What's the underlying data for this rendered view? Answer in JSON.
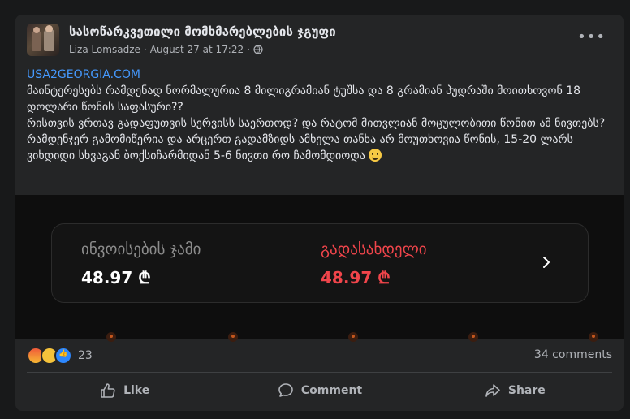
{
  "header": {
    "group_name": "სასოწარკვეთილი მომხმარებლების ჯგუფი",
    "author": "Liza Lomsadze",
    "separator": "·",
    "time": "August 27 at 17:22",
    "separator2": "·",
    "more_label": "•••"
  },
  "post": {
    "link": "USA2GEORGIA.COM",
    "line1": "მაინტერესებს რამდენად ნორმალურია 8 მილიგრამიან ტუშსა და 8 გრამიან პუდრაში მოითხოვონ 18 დოლარი წონის საფასური??",
    "line2": "რისთვის ვრთავ გადაფუთვის სერვისს საერთოდ? და რატომ მითვლიან მოცულობითი წონით ამ ნივთებს?",
    "line3": "რამდენჯერ გამომიწერია და არცერთ გადამზიდს ამხელა თანხა არ მოუთხოვია წონის, 15-20 ლარს ვიხდიდი სხვაგან ბოქსიჩარმიდან 5-6 ნივთი რო ჩამომდიოდა"
  },
  "invoice": {
    "total_label": "ინვოისების ჯამი",
    "total_amount": "48.97 ₾",
    "due_label": "გადასახდელი",
    "due_amount": "48.97 ₾",
    "due_color": "#f0454b"
  },
  "footer": {
    "reaction_count": "23",
    "reactions": [
      "angry",
      "sad",
      "like"
    ],
    "comments_count": "34 comments",
    "like_label": "Like",
    "comment_label": "Comment",
    "share_label": "Share"
  },
  "colors": {
    "background": "#18191a",
    "card": "#242526",
    "link": "#4599ff"
  }
}
